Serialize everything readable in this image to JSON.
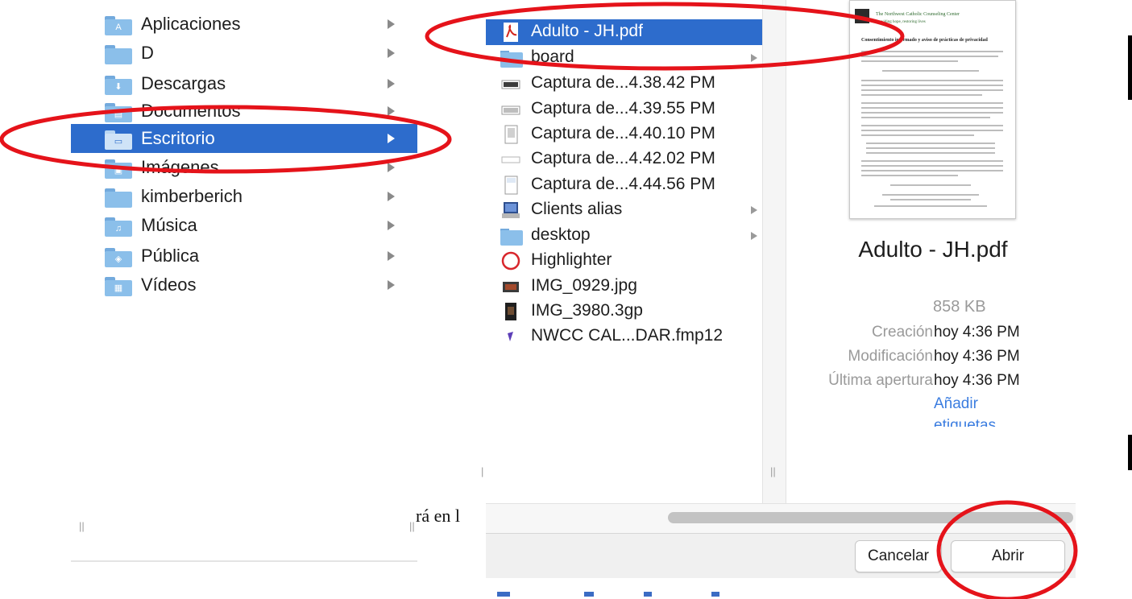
{
  "left_panel": {
    "items": [
      {
        "label": "Aplicaciones",
        "icon": "apps-folder-icon"
      },
      {
        "label": "D",
        "icon": "folder-icon"
      },
      {
        "label": "Descargas",
        "icon": "downloads-folder-icon"
      },
      {
        "label": "Documentos",
        "icon": "documents-folder-icon"
      },
      {
        "label": "Escritorio",
        "icon": "desktop-folder-icon",
        "selected": true
      },
      {
        "label": "Imágenes",
        "icon": "pictures-folder-icon"
      },
      {
        "label": "kimberberich",
        "icon": "folder-icon"
      },
      {
        "label": "Música",
        "icon": "music-folder-icon"
      },
      {
        "label": "Pública",
        "icon": "public-folder-icon"
      },
      {
        "label": "Vídeos",
        "icon": "movies-folder-icon"
      }
    ]
  },
  "background_text": "rá en l",
  "file_list": {
    "items": [
      {
        "label": "Adulto - JH.pdf",
        "icon": "pdf-file-icon",
        "selected": true,
        "has_arrow": false
      },
      {
        "label": "board",
        "icon": "folder-icon",
        "has_arrow": true
      },
      {
        "label": "Captura de...4.38.42 PM",
        "icon": "screenshot-file-icon",
        "has_arrow": false
      },
      {
        "label": "Captura de...4.39.55 PM",
        "icon": "screenshot-file-icon",
        "has_arrow": false
      },
      {
        "label": "Captura de...4.40.10 PM",
        "icon": "screenshot-file-icon",
        "has_arrow": false
      },
      {
        "label": "Captura de...4.42.02 PM",
        "icon": "screenshot-file-icon",
        "has_arrow": false
      },
      {
        "label": "Captura de...4.44.56 PM",
        "icon": "screenshot-file-icon",
        "has_arrow": false
      },
      {
        "label": "Clients alias",
        "icon": "alias-icon",
        "has_arrow": true
      },
      {
        "label": "desktop",
        "icon": "folder-icon",
        "has_arrow": true
      },
      {
        "label": "Highlighter",
        "icon": "highlighter-app-icon",
        "has_arrow": false
      },
      {
        "label": "IMG_0929.jpg",
        "icon": "image-file-icon",
        "has_arrow": false
      },
      {
        "label": "IMG_3980.3gp",
        "icon": "video-file-icon",
        "has_arrow": false
      },
      {
        "label": "NWCC CAL...DAR.fmp12",
        "icon": "filemaker-file-icon",
        "has_arrow": false
      }
    ]
  },
  "preview": {
    "doc_title": "The Northwest Catholic Counseling Center",
    "doc_subtitle": "Providing hope, restoring lives",
    "doc_heading": "Consentimiento informado y aviso de prácticas de privacidad",
    "file_name": "Adulto - JH.pdf",
    "size": "858 KB",
    "meta": [
      {
        "key": "Creación",
        "value": "hoy 4:36 PM"
      },
      {
        "key": "Modificación",
        "value": "hoy 4:36 PM"
      },
      {
        "key": "Última apertura",
        "value": "hoy 4:36 PM"
      }
    ],
    "tags_link_1": "Añadir",
    "tags_link_2": "etiquetas"
  },
  "buttons": {
    "cancel": "Cancelar",
    "open": "Abrir"
  },
  "colors": {
    "selection": "#2d6ccc",
    "annotation": "#e5131a",
    "link": "#3b7de0"
  }
}
